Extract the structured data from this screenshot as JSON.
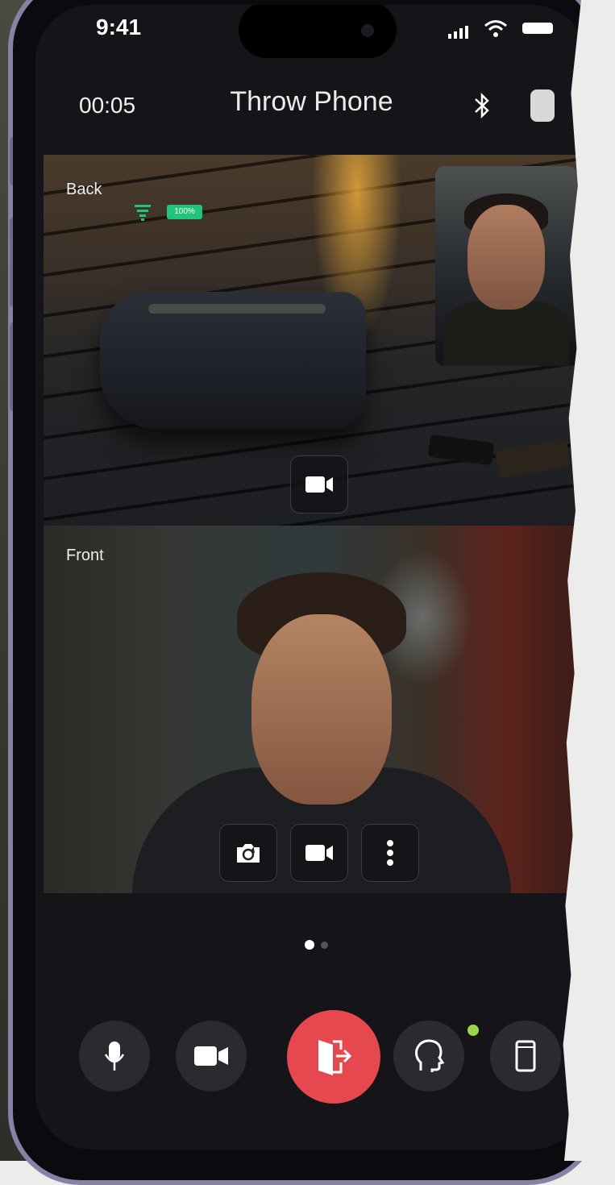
{
  "status_bar": {
    "time": "9:41"
  },
  "header": {
    "timer": "00:05",
    "title": "Throw Phone"
  },
  "back_camera": {
    "label": "Back",
    "battery": "100%"
  },
  "front_camera": {
    "label": "Front"
  },
  "pager": {
    "active_page": 1,
    "total_pages": 2
  },
  "colors": {
    "accent_red": "#e5484f",
    "battery_green": "#22c47c",
    "indicator_green": "#9ad64a"
  },
  "icons": [
    "bluetooth-icon",
    "phone-icon",
    "video-camera-icon",
    "camera-switch-icon",
    "more-icon",
    "microphone-icon",
    "exit-door-icon",
    "head-icon"
  ]
}
